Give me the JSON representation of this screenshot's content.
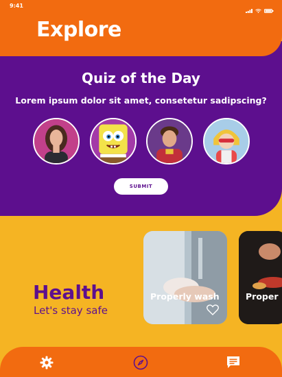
{
  "status_bar": {
    "time": "9:41",
    "icons": [
      "signal-icon",
      "wifi-icon",
      "battery-icon"
    ]
  },
  "header": {
    "title": "Explore"
  },
  "quiz": {
    "title": "Quiz of the Day",
    "question": "Lorem ipsum dolor sit amet, consetetur sadipscing?",
    "options": [
      "avatar-1",
      "avatar-2",
      "avatar-3",
      "avatar-4"
    ],
    "submit_label": "SUBMIT"
  },
  "health": {
    "title": "Health",
    "subtitle": "Let's stay safe"
  },
  "cards": [
    {
      "label": "Properly wash"
    },
    {
      "label": "Proper"
    }
  ],
  "bottom_nav": {
    "items": [
      "settings-icon",
      "compass-icon",
      "chat-icon"
    ]
  },
  "colors": {
    "orange": "#f26b10",
    "purple": "#5d0f8e",
    "yellow": "#f5b423"
  }
}
